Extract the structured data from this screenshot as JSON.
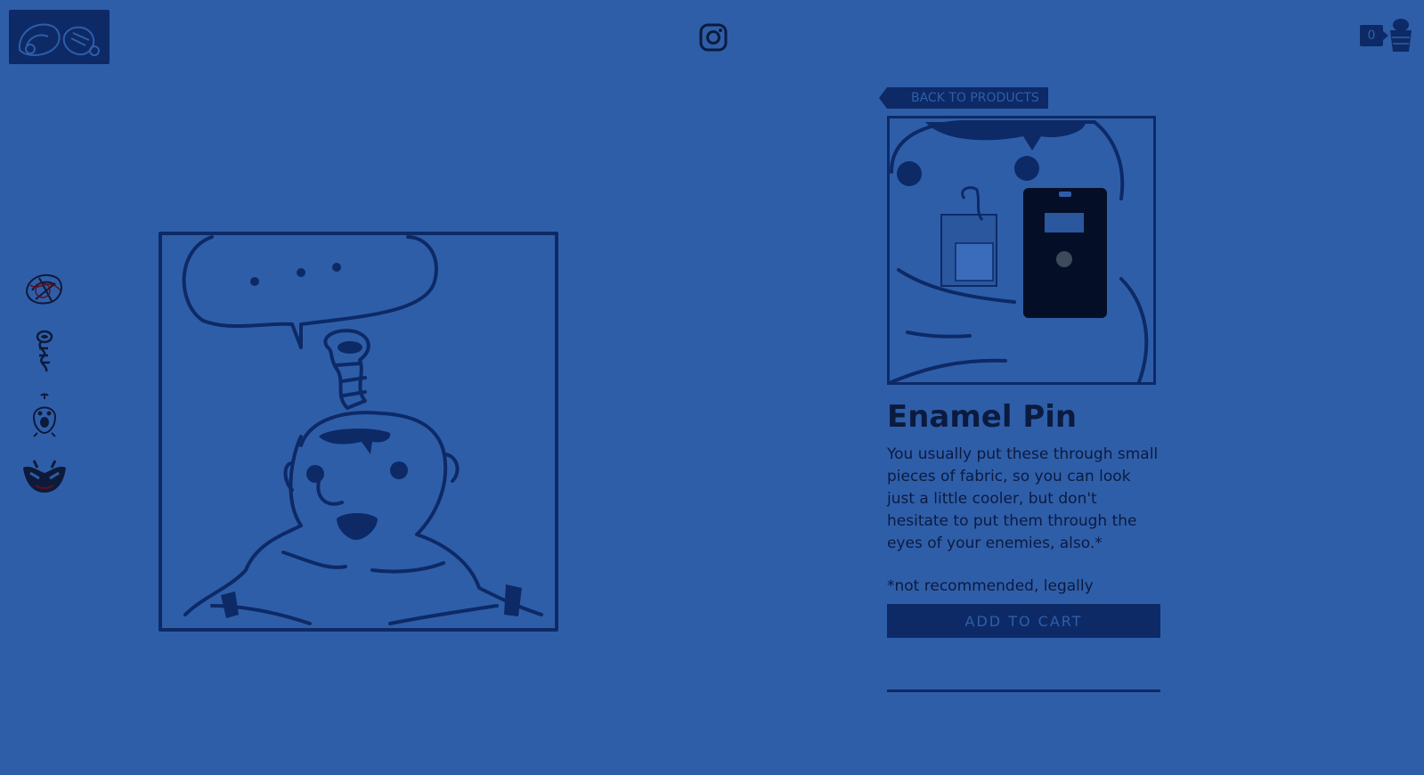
{
  "header": {
    "logo_icon": "seafood-logo-icon",
    "social_icon": "instagram-icon",
    "cart_count": "0",
    "cart_icon": "cart-bucket-icon"
  },
  "sidebar": {
    "items": [
      {
        "icon": "shrimp-doodle-icon"
      },
      {
        "icon": "worm-doodle-icon"
      },
      {
        "icon": "creature-doodle-icon"
      },
      {
        "icon": "mask-doodle-icon"
      }
    ]
  },
  "product": {
    "back_label": "BACK TO PRODUCTS",
    "title": "Enamel Pin",
    "description": "You usually put these through small pieces of fabric, so you can look just a little cooler, but don't hesitate to put them through the eyes of your enemies, also.*",
    "note": "*not recommended, legally",
    "add_to_cart_label": "ADD TO CART"
  },
  "colors": {
    "background": "#2f5ea9",
    "ink": "#0d2a66",
    "text": "#0b1b3f"
  }
}
